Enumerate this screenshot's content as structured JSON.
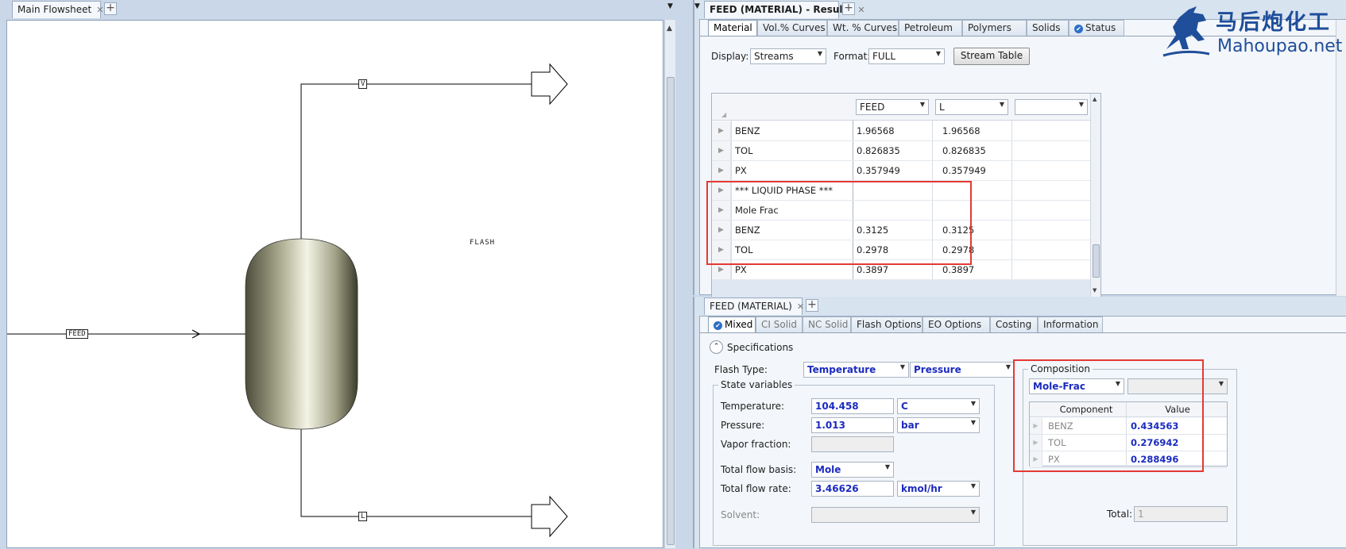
{
  "left": {
    "tab_title": "Main Flowsheet",
    "flowsheet": {
      "block_label": "FLASH",
      "streams": {
        "feed": "FEED",
        "vapor": "V",
        "liquid": "L"
      }
    }
  },
  "results": {
    "tab_title": "FEED (MATERIAL) - Results",
    "tabs": [
      "Material",
      "Vol.% Curves",
      "Wt. % Curves",
      "Petroleum",
      "Polymers",
      "Solids",
      "Status"
    ],
    "display_label": "Display:",
    "display_value": "Streams",
    "format_label": "Format:",
    "format_value": "FULL",
    "stream_table_button": "Stream Table",
    "columns": [
      "FEED",
      "L",
      ""
    ],
    "rows": [
      {
        "label": "BENZ",
        "feed": "1.96568",
        "l": "1.96568"
      },
      {
        "label": "TOL",
        "feed": "0.826835",
        "l": "0.826835"
      },
      {
        "label": "PX",
        "feed": "0.357949",
        "l": "0.357949"
      },
      {
        "label": "*** LIQUID PHASE ***",
        "feed": "",
        "l": ""
      },
      {
        "label": "Mole Frac",
        "feed": "",
        "l": ""
      },
      {
        "label": "BENZ",
        "feed": "0.3125",
        "l": "0.3125"
      },
      {
        "label": "TOL",
        "feed": "0.2978",
        "l": "0.2978"
      },
      {
        "label": "PX",
        "feed": "0.3897",
        "l": "0.3897"
      }
    ]
  },
  "input": {
    "tab_title": "FEED (MATERIAL)",
    "tabs": [
      "Mixed",
      "CI Solid",
      "NC Solid",
      "Flash Options",
      "EO Options",
      "Costing",
      "Information"
    ],
    "specifications_label": "Specifications",
    "flash_type_label": "Flash Type:",
    "flash_type_1": "Temperature",
    "flash_type_2": "Pressure",
    "state_variables_label": "State variables",
    "temperature_label": "Temperature:",
    "temperature_value": "104.458",
    "temperature_unit": "C",
    "pressure_label": "Pressure:",
    "pressure_value": "1.013",
    "pressure_unit": "bar",
    "vapor_fraction_label": "Vapor fraction:",
    "total_flow_basis_label": "Total flow basis:",
    "total_flow_basis_value": "Mole",
    "total_flow_rate_label": "Total flow rate:",
    "total_flow_rate_value": "3.46626",
    "total_flow_rate_unit": "kmol/hr",
    "solvent_label": "Solvent:",
    "composition_label": "Composition",
    "composition_basis": "Mole-Frac",
    "composition_headers": [
      "Component",
      "Value"
    ],
    "composition_rows": [
      {
        "component": "BENZ",
        "value": "0.434563"
      },
      {
        "component": "TOL",
        "value": "0.276942"
      },
      {
        "component": "PX",
        "value": "0.288496"
      }
    ],
    "total_label": "Total:",
    "total_value": "1"
  },
  "watermark": {
    "chinese": "马后炮化工",
    "site": "Mahoupao.net"
  },
  "colors": {
    "accent_blue": "#1b2bbf",
    "highlight_red": "#e53935",
    "pane_bg": "#d8e3f0"
  }
}
